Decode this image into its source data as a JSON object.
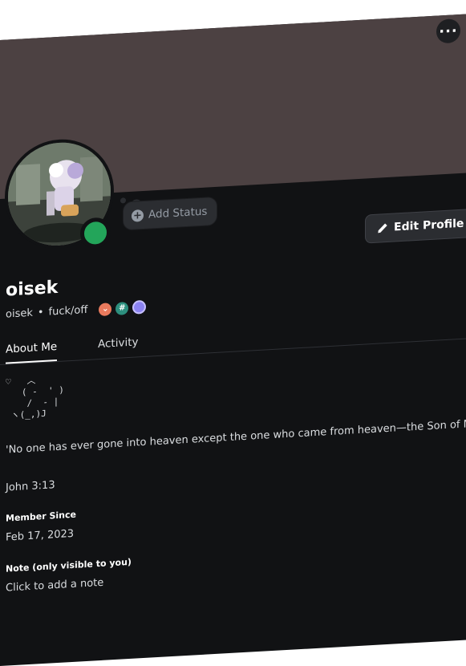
{
  "menu": {
    "icon": "ellipsis-icon",
    "label": "···"
  },
  "status": {
    "label": "Add Status",
    "icon": "plus-circle-icon",
    "icon_glyph": "+"
  },
  "edit_profile": {
    "label": "Edit Profile",
    "icon": "pencil-icon"
  },
  "user": {
    "display_name": "oisek",
    "username": "oisek",
    "separator": "•",
    "pronouns": "fuck/off",
    "presence": "online"
  },
  "badges": [
    {
      "name": "hypesquad-badge",
      "glyph": "⌄"
    },
    {
      "name": "hashtag-badge",
      "glyph": "#"
    },
    {
      "name": "nitro-badge",
      "glyph": ""
    }
  ],
  "tabs": [
    {
      "label": "About Me",
      "active": true
    },
    {
      "label": "Activity",
      "active": false
    }
  ],
  "about": {
    "ascii": "♡   ︿\n   ( -  ' )\n    /  - |\n ヽ(_,)J",
    "quote": "'No one has ever gone into heaven except the one who came from heaven—the Son of Man. '",
    "verse": "John 3:13"
  },
  "member_since": {
    "label": "Member Since",
    "value": "Feb 17, 2023"
  },
  "note": {
    "label": "Note (only visible to you)",
    "placeholder": "Click to add a note"
  },
  "colors": {
    "banner": "#4c4142",
    "background": "#111214",
    "presence": "#23a55a"
  }
}
